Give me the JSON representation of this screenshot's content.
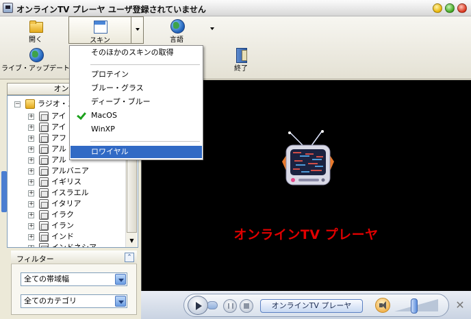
{
  "window": {
    "title": "オンラインTV プレーヤ ユーザ登録されていません"
  },
  "toolbar": {
    "open_label": "開く",
    "skin_label": "スキン",
    "language_label": "言語",
    "live_update_label": "ライブ・アップデート",
    "exit_label": "終了"
  },
  "skin_menu": {
    "items": [
      {
        "label": "そのほかのスキンの取得",
        "checked": false,
        "selected": false
      },
      {
        "label": "プロテイン",
        "checked": false,
        "selected": false
      },
      {
        "label": "ブルー・グラス",
        "checked": false,
        "selected": false
      },
      {
        "label": "ディープ・ブルー",
        "checked": false,
        "selected": false
      },
      {
        "label": "MacOS",
        "checked": true,
        "selected": false
      },
      {
        "label": "WinXP",
        "checked": false,
        "selected": false
      },
      {
        "label": "ロワイヤル",
        "checked": false,
        "selected": true
      }
    ]
  },
  "left_panel": {
    "header": "オンライン",
    "tree": {
      "root": "ラジオ・ス",
      "items": [
        "アイ",
        "アイ",
        "アフ",
        "アル",
        "アル",
        "アルバニア",
        "イギリス",
        "イスラエル",
        "イタリア",
        "イラク",
        "イラン",
        "インド",
        "インドネシア"
      ]
    }
  },
  "filter": {
    "title": "フィルター",
    "bandwidth_value": "全ての帯域幅",
    "category_value": "全てのカテゴリ"
  },
  "video": {
    "title": "オンラインTV プレーヤ"
  },
  "controls": {
    "channel_button_label": "オンラインTV プレーヤ",
    "close_symbol": "✕"
  },
  "colors": {
    "video_title": "#e00000",
    "menu_highlight": "#316ac5",
    "check_mark": "#1ca11c"
  },
  "icons": {
    "open": "folder-icon",
    "skin": "skin-icon",
    "language": "globe-icon",
    "live_update": "globe-update-icon",
    "exit": "exit-door-icon"
  }
}
